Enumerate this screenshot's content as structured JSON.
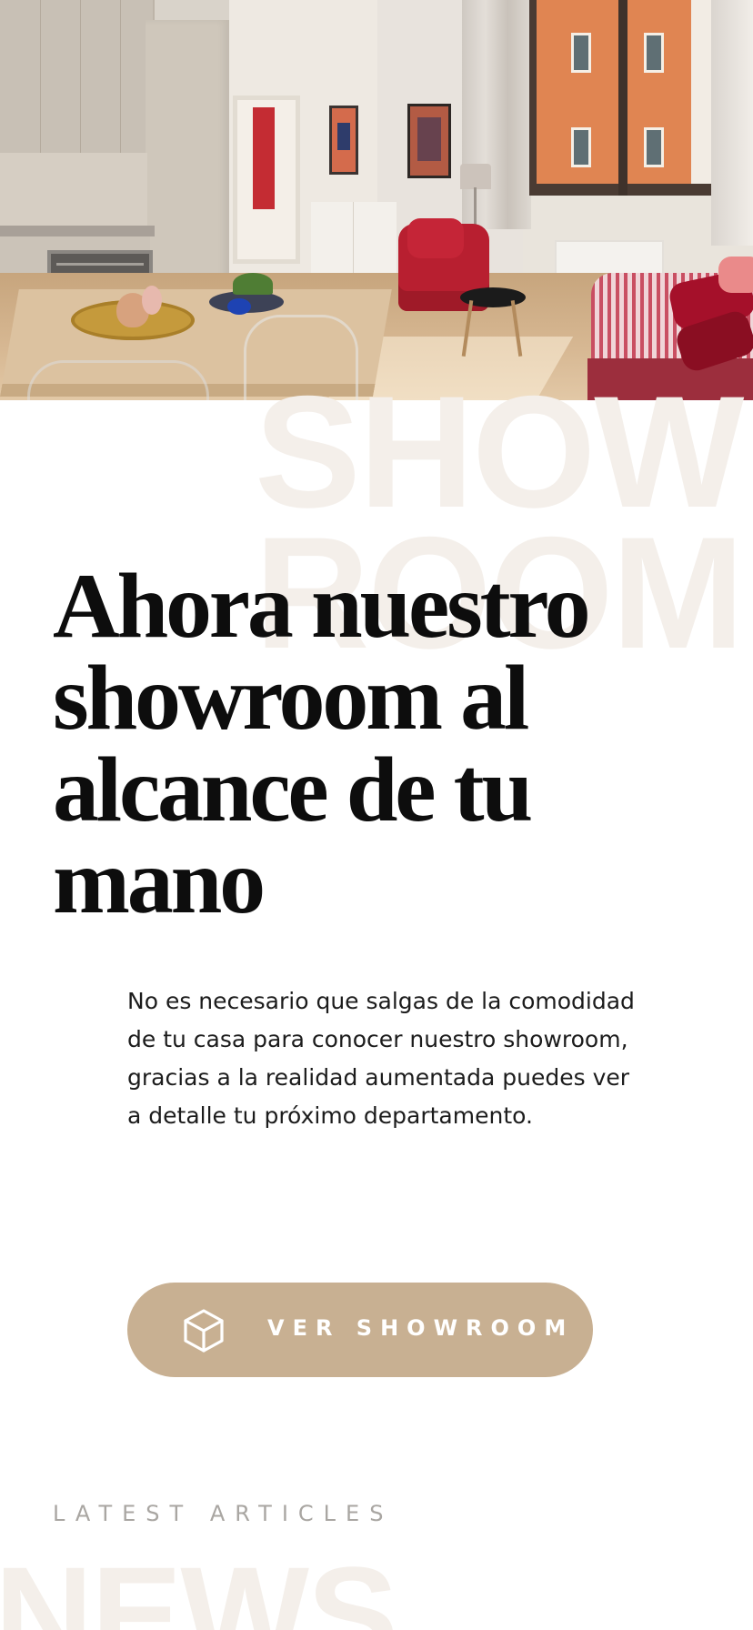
{
  "hero": {
    "image_description": "Bright apartment interior with kitchen, dining table, red armchair, striped sofa and window"
  },
  "background_words": {
    "line1": "SHOW",
    "line2": "ROOM",
    "news": "NEWS"
  },
  "showroom": {
    "headline_lines": [
      "Ahora nuestro",
      "showroom al",
      "alcance de tu",
      "mano"
    ],
    "description": "No es necesario que salgas de la comodidad de tu casa para conocer nuestro showroom, gracias a la realidad aumentada puedes ver a detalle tu próximo departamento.",
    "cta_label": "VER SHOWROOM",
    "cta_icon": "cube-icon"
  },
  "articles": {
    "eyebrow": "LATEST ARTICLES"
  },
  "colors": {
    "accent": "#c8b092",
    "watermark": "#f4efea",
    "text": "#0d0d0d",
    "muted": "#a9a6a2"
  }
}
